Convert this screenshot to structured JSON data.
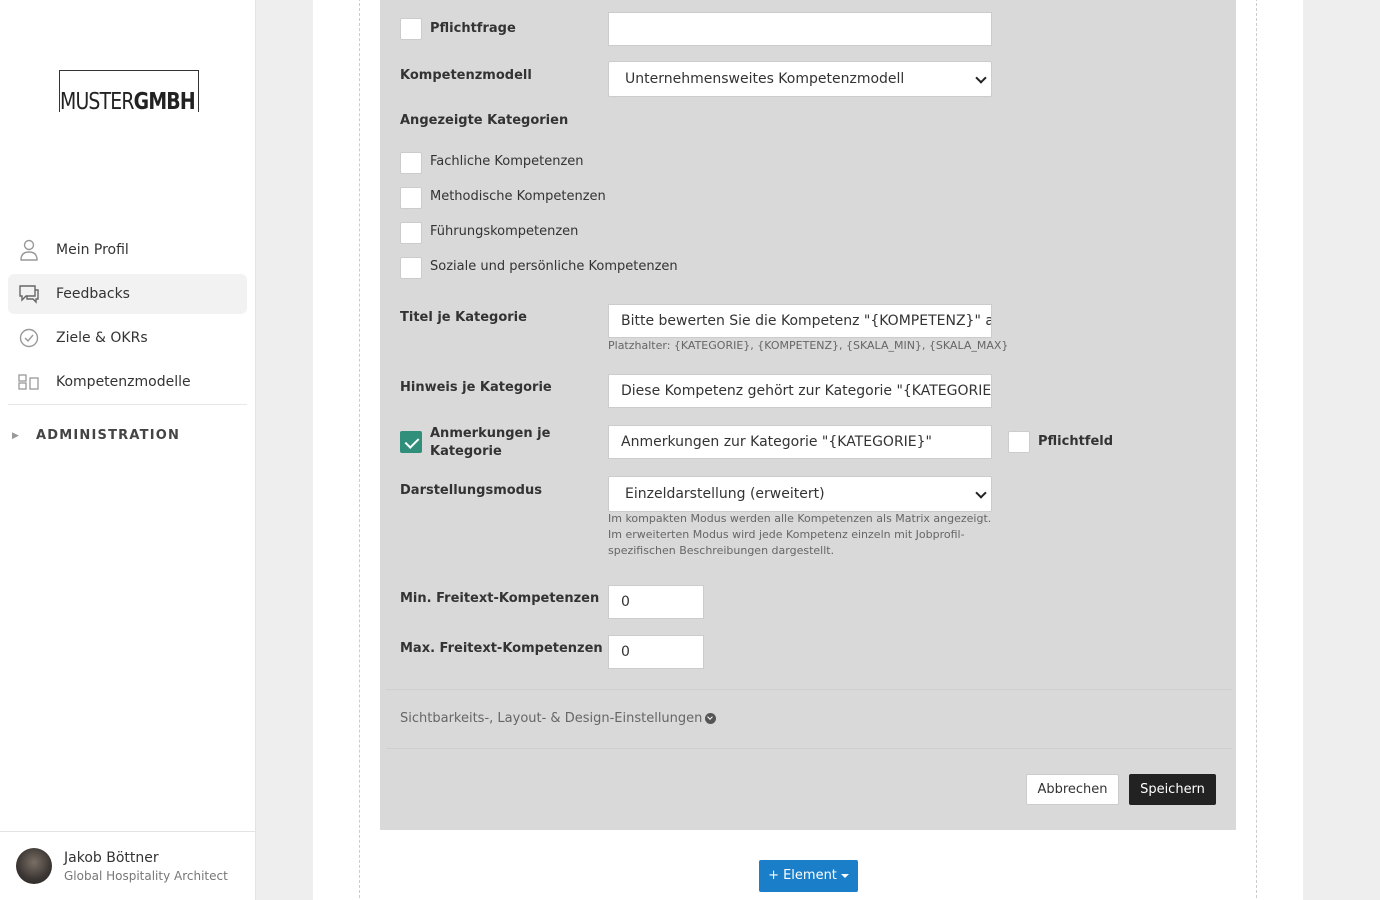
{
  "brand": {
    "logo_light": "MUSTER",
    "logo_bold": "GMBH"
  },
  "sidebar": {
    "items": [
      {
        "label": "Mein Profil",
        "icon": "user-icon",
        "active": false
      },
      {
        "label": "Feedbacks",
        "icon": "chat-icon",
        "active": true
      },
      {
        "label": "Ziele & OKRs",
        "icon": "check-circle-icon",
        "active": false
      },
      {
        "label": "Kompetenzmodelle",
        "icon": "grid-icon",
        "active": false
      }
    ],
    "admin_label": "ADMINISTRATION"
  },
  "user": {
    "name": "Jakob Böttner",
    "role": "Global Hospitality Architect"
  },
  "form": {
    "required_question": {
      "label": "Pflichtfrage",
      "checked": false,
      "value": ""
    },
    "competency_model": {
      "label": "Kompetenzmodell",
      "value": "Unternehmensweites Kompetenzmodell"
    },
    "categories": {
      "label": "Angezeigte Kategorien",
      "items": [
        {
          "label": "Fachliche Kompetenzen",
          "checked": false
        },
        {
          "label": "Methodische Kompetenzen",
          "checked": false
        },
        {
          "label": "Führungskompetenzen",
          "checked": false
        },
        {
          "label": "Soziale und persönliche Kompetenzen",
          "checked": false
        }
      ]
    },
    "title_per_category": {
      "label": "Titel je Kategorie",
      "value": "Bitte bewerten Sie die Kompetenz \"{KOMPETENZ}\" au",
      "hint": "Platzhalter: {KATEGORIE}, {KOMPETENZ}, {SKALA_MIN}, {SKALA_MAX}"
    },
    "hint_per_category": {
      "label": "Hinweis je Kategorie",
      "value": "Diese Kompetenz gehört zur Kategorie \"{KATEGORIE}\""
    },
    "notes_per_category": {
      "label": "Anmerkungen je Kategorie",
      "checked": true,
      "value": "Anmerkungen zur Kategorie \"{KATEGORIE}\"",
      "required_label": "Pflichtfeld",
      "required_checked": false
    },
    "display_mode": {
      "label": "Darstellungsmodus",
      "value": "Einzeldarstellung (erweitert)",
      "hint": "Im kompakten Modus werden alle Kompetenzen als Matrix angezeigt. Im erweiterten Modus wird jede Kompetenz einzeln mit Jobprofil-spezifischen Beschreibungen dargestellt."
    },
    "min_freetext": {
      "label": "Min. Freitext-Kompetenzen",
      "value": "0"
    },
    "max_freetext": {
      "label": "Max. Freitext-Kompetenzen",
      "value": "0"
    },
    "settings_toggle": "Sichtbarkeits-, Layout- & Design-Einstellungen",
    "cancel_label": "Abbrechen",
    "save_label": "Speichern"
  },
  "add_element_label": "+ Element",
  "colors": {
    "accent": "#1a7ec8",
    "check": "#2f8f7a",
    "panel": "#d9d9d9",
    "dark_button": "#222222"
  }
}
